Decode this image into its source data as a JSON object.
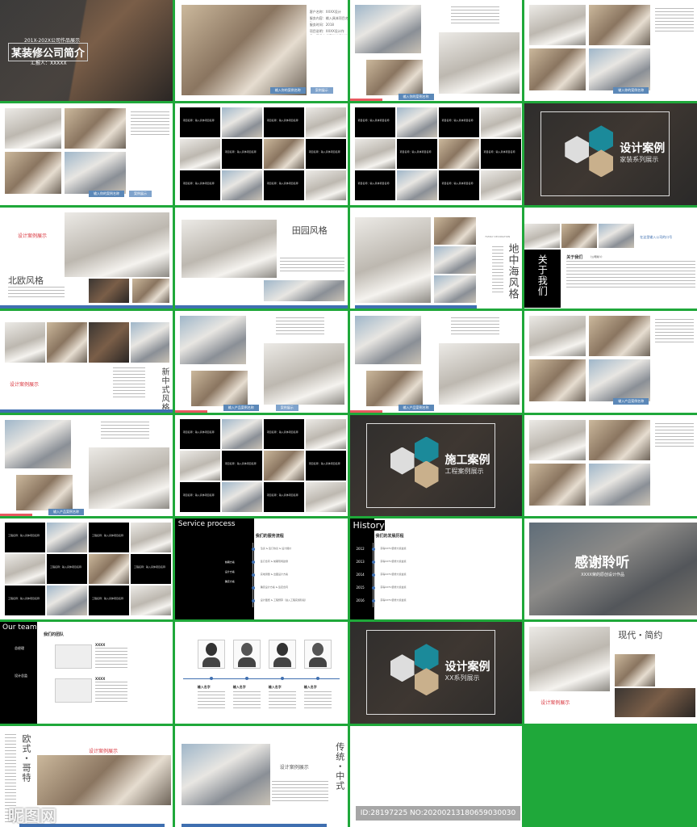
{
  "colors": {
    "border": "#1fa83a",
    "accent": "#3f6fb0",
    "red": "#d9363e",
    "teal": "#1b8a9a"
  },
  "slides": [
    {
      "type": "cover",
      "sub": "201X-202X公司作品展示",
      "title": "某装修公司简介",
      "reporter": "汇报人：XXXXX"
    },
    {
      "type": "info",
      "lines": [
        "客户名称：XXXX设计",
        "服务内容：输入具体项目名称",
        "服务时间：2018",
        "项目说明：XXXX设计作品，是具有代表性的设计作品，请勿盗用！"
      ],
      "caption": "输入你的案例名称",
      "tag": "案例展示"
    },
    {
      "type": "photos3",
      "caption": "输入你的案例名称"
    },
    {
      "type": "photos4",
      "caption": "输入你的案例名称"
    },
    {
      "type": "photos4",
      "caption": "输入你的案例名称",
      "tag": "案例展示"
    },
    {
      "type": "grid",
      "label": "项目名称：输入具体项目名称"
    },
    {
      "type": "grid",
      "label": "项目名称：输入具体项目名称"
    },
    {
      "type": "section",
      "title": "设计案例",
      "sub": "家装系列展示",
      "icon": "home-icon"
    },
    {
      "type": "style",
      "heading": "设计案例展示",
      "title": "北欧风格"
    },
    {
      "type": "style2",
      "title": "田园风格"
    },
    {
      "type": "style3",
      "eng": "FAMILY DECORATION",
      "title": "地中海风格"
    },
    {
      "type": "about",
      "title": "关于我们",
      "heading": "关于我们",
      "note": "（公司简介）",
      "slogan": "在这里输入公司的口号"
    },
    {
      "type": "style4",
      "heading": "设计案例展示",
      "title": "新中式风格"
    },
    {
      "type": "photos3",
      "caption": "输入产品案例名称",
      "tag": "案例展示"
    },
    {
      "type": "photos3",
      "caption": "输入产品案例名称"
    },
    {
      "type": "photos4",
      "caption": "输入产品案例名称"
    },
    {
      "type": "photos3",
      "caption": "输入产品案例名称"
    },
    {
      "type": "grid",
      "label": "项目名称：输入具体项目名称"
    },
    {
      "type": "section",
      "title": "施工案例",
      "sub": "工程案例展示",
      "icon": "crane-icon"
    },
    {
      "type": "photos4"
    },
    {
      "type": "grid",
      "label": "工程名称：输入具体项目名称"
    },
    {
      "type": "timeline",
      "eng": "Service process",
      "heading": "我们的服务流程",
      "items": [
        "洽谈 & 签订协议 & 设计报价",
        "签订合同 & 前期现场勘测",
        "实地测量 & 出图设计方案",
        "确定设计方案 & 签定合同",
        "设计图纸 & 工程预算（进入工程实施阶段）"
      ],
      "side": [
        "前期方案",
        "设计方案",
        "确定方案"
      ]
    },
    {
      "type": "history",
      "eng": "History",
      "heading": "我们的发展历程",
      "years": [
        "2012",
        "2013",
        "2014",
        "2015",
        "2016"
      ],
      "item": "获得XXTV装修大奖金奖"
    },
    {
      "type": "thanks",
      "title": "感谢聆听",
      "sub": "XXXX荣的原创设计作品"
    },
    {
      "type": "team",
      "eng": "Our team",
      "heading": "我们的团队",
      "roles": [
        "总经理",
        "设计总监"
      ],
      "name": "XXXX"
    },
    {
      "type": "people",
      "name": "输入名字"
    },
    {
      "type": "section",
      "title": "设计案例",
      "sub": "XX系列展示",
      "icon": "photo-icon"
    },
    {
      "type": "modern",
      "title": "现代・简约",
      "heading": "设计案例展示"
    },
    {
      "type": "euro",
      "title": "欧式・哥特",
      "heading": "设计案例展示"
    },
    {
      "type": "chinese",
      "title": "传统・中式",
      "heading": "设计案例展示"
    },
    {
      "type": "blank"
    }
  ],
  "watermark": {
    "site": "昵图网 www.nipic.com",
    "id": "ID:28197225 NO:20200213180659030030"
  }
}
